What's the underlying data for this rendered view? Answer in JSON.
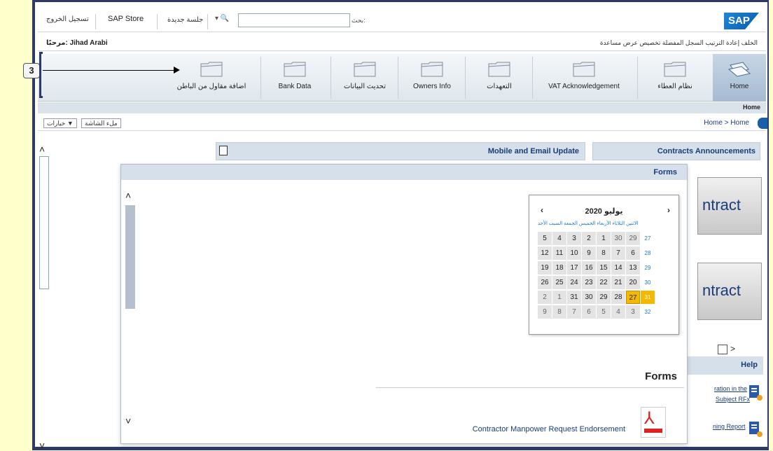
{
  "callout": {
    "number": "3"
  },
  "topbar": {
    "logout": "تسجيل الخروج",
    "sap_store": "SAP Store",
    "new_session": "جلسة جديدة",
    "search_scope": "▾ 🔍",
    "search_value": "",
    "search_label": "بحث:",
    "logo": "SAP"
  },
  "userbar": {
    "welcome": "مرحبًا: Jihad Arabi",
    "menu": "الخلف  إعادة الترتيب  السجل  المفضلة  تخصيص  عرض  مساعدة"
  },
  "nav": {
    "items": [
      {
        "label": "اضافة مقاول من الباطن",
        "icon": "folder-icon"
      },
      {
        "label": "Bank Data",
        "icon": "folder-icon"
      },
      {
        "label": "تحديث البيانات",
        "icon": "folder-icon"
      },
      {
        "label": "Owners Info",
        "icon": "folder-icon"
      },
      {
        "label": "التعهدات",
        "icon": "folder-icon"
      },
      {
        "label": "VAT Acknowledgement",
        "icon": "folder-icon"
      },
      {
        "label": "نظام العطاء",
        "icon": "folder-icon"
      },
      {
        "label": "Home",
        "icon": "home-folders-icon"
      }
    ],
    "subnav_active": "Home"
  },
  "breadcrumb": {
    "text": "Home > Home",
    "full_page_btn": "ملء الشاشة",
    "options_btn": "خيارات ▼"
  },
  "portlets": {
    "mobile_title": "Mobile and Email Update",
    "contracts_title": "Contracts Announcements",
    "contract_card_text": "ntract",
    "help_title": "Help",
    "help_link_1a": "ration in the",
    "help_link_1b": "Subject RFx",
    "help_link_2": "ning Report"
  },
  "forms_dialog": {
    "header": "Forms",
    "heading": "Forms",
    "link": "Contractor Manpower Request Endorsement"
  },
  "calendar": {
    "month_label": "يوليو 2020",
    "prev": "‹",
    "next": "›",
    "daynames": "الاثنين الثلاثاء الأربعاء الخميس الجمعة السبت الأحد",
    "selected_day": "27",
    "rows": [
      {
        "days": [
          "5",
          "4",
          "3",
          "2",
          "1",
          "30",
          "29"
        ],
        "week": "27"
      },
      {
        "days": [
          "12",
          "11",
          "10",
          "9",
          "8",
          "7",
          "6"
        ],
        "week": "28"
      },
      {
        "days": [
          "19",
          "18",
          "17",
          "16",
          "15",
          "14",
          "13"
        ],
        "week": "29"
      },
      {
        "days": [
          "26",
          "25",
          "24",
          "23",
          "22",
          "21",
          "20"
        ],
        "week": "30"
      },
      {
        "days": [
          "2",
          "1",
          "31",
          "30",
          "29",
          "28",
          "27"
        ],
        "week": "31"
      },
      {
        "days": [
          "9",
          "8",
          "7",
          "6",
          "5",
          "4",
          "3"
        ],
        "week": "32"
      }
    ]
  },
  "colors": {
    "accent": "#1a3c78",
    "selected": "#f5b800",
    "header_band": "#d6e0ea"
  }
}
